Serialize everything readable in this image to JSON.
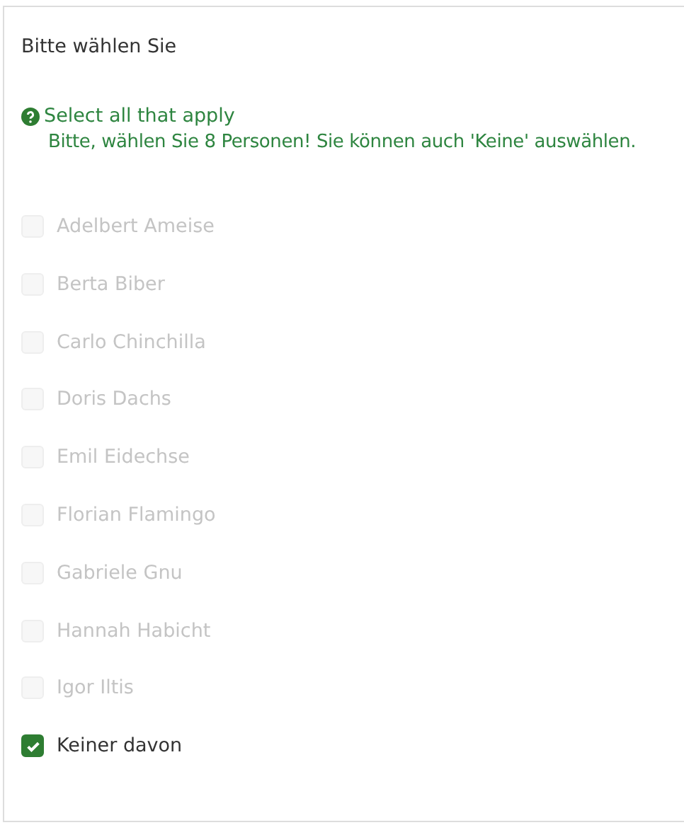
{
  "question": {
    "title": "Bitte wählen Sie",
    "hint": "Select all that apply",
    "instruction": "Bitte, wählen Sie 8 Personen! Sie können auch 'Keine' auswählen."
  },
  "options": [
    {
      "label": "Adelbert Ameise",
      "checked": false,
      "disabled": true
    },
    {
      "label": "Berta Biber",
      "checked": false,
      "disabled": true
    },
    {
      "label": "Carlo Chinchilla",
      "checked": false,
      "disabled": true
    },
    {
      "label": "Doris Dachs",
      "checked": false,
      "disabled": true
    },
    {
      "label": "Emil Eidechse",
      "checked": false,
      "disabled": true
    },
    {
      "label": "Florian Flamingo",
      "checked": false,
      "disabled": true
    },
    {
      "label": "Gabriele Gnu",
      "checked": false,
      "disabled": true
    },
    {
      "label": "Hannah Habicht",
      "checked": false,
      "disabled": true
    },
    {
      "label": "Igor Iltis",
      "checked": false,
      "disabled": true
    },
    {
      "label": "Keiner davon",
      "checked": true,
      "disabled": false
    }
  ]
}
